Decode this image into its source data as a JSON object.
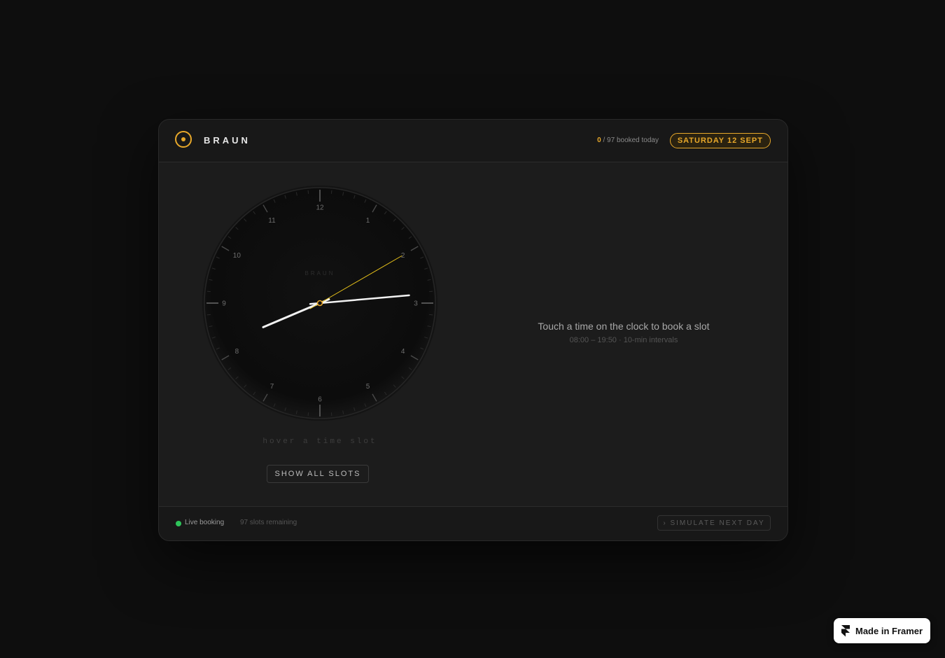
{
  "brand": "BRAUN",
  "header": {
    "booked_count": "0",
    "booked_rest": " / 97 booked today",
    "date": "SATURDAY 12 SEPT"
  },
  "clock": {
    "face_brand": "BRAUN",
    "numerals": [
      "12",
      "1",
      "2",
      "3",
      "4",
      "5",
      "6",
      "7",
      "8",
      "9",
      "10",
      "11"
    ],
    "time": {
      "hour": 8,
      "minute": 14,
      "second": 10
    },
    "accent_color": "#e8a82a"
  },
  "hover_text": "hover a time slot",
  "show_all_label": "SHOW ALL SLOTS",
  "prompt": {
    "title": "Touch a time on the clock to book a slot",
    "subtitle": "08:00 – 19:50 · 10-min intervals"
  },
  "footer": {
    "live_label": "Live booking",
    "remaining": "97 slots remaining",
    "simulate_label": "› SIMULATE NEXT DAY"
  },
  "badge": {
    "label": "Made in Framer"
  },
  "colors": {
    "accent": "#e8a82a",
    "live": "#2ec45a",
    "background": "#0e0e0e"
  }
}
